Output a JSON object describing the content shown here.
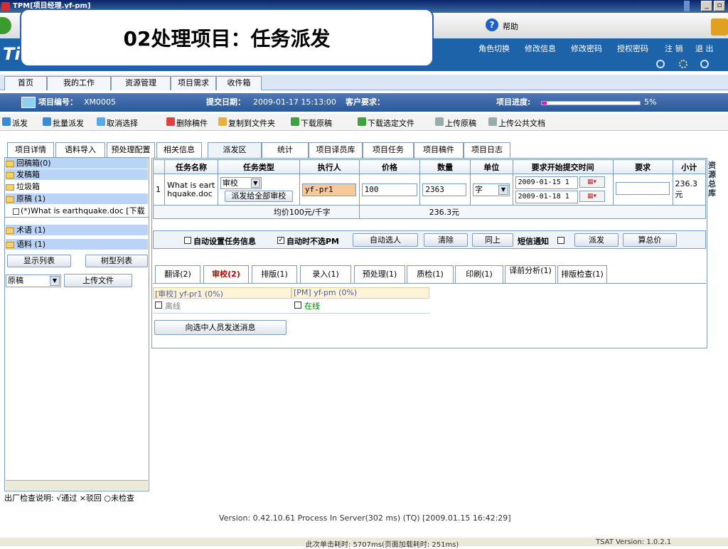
{
  "window": {
    "title": "TPM[项目经理.yf-pm]"
  },
  "toolbar": {
    "help_label": "帮助"
  },
  "overlay": {
    "title": "02处理项目：任务派发"
  },
  "brand": "Ti",
  "header_links": [
    "角色切换",
    "修改信息",
    "修改密码",
    "授权密码",
    "注 销",
    "退 出"
  ],
  "nav": {
    "tabs": [
      "首页",
      "我的工作",
      "资源管理",
      "项目需求",
      "收件箱"
    ]
  },
  "project": {
    "number_label": "项目编号：",
    "number": "XM0005",
    "date_label": "提交日期：",
    "date": "2009-01-17 15:13:00",
    "customer_label": "客户要求：",
    "progress_label": "项目进度:",
    "progress_pct": 5,
    "progress_text": "5%"
  },
  "actions": [
    "派发",
    "批量派发",
    "取消选择",
    "删除稿件",
    "复制到文件夹",
    "下载原稿",
    "下载选定文件",
    "上传原稿",
    "上传公共文档"
  ],
  "left_tabs": [
    "项目详情",
    "语料导入",
    "预处理配置"
  ],
  "tree": [
    {
      "label": "回稿箱(0)",
      "selected": true
    },
    {
      "label": "发稿箱",
      "selected": true
    },
    {
      "label": "垃圾箱",
      "selected": false
    },
    {
      "label": "原稿 (1)",
      "selected": true
    },
    {
      "label": "(*)What is earthquake.doc [下载",
      "selected": false
    },
    {
      "label": "术语 (1)",
      "selected": true
    },
    {
      "label": "语料 (1)",
      "selected": true
    }
  ],
  "left_buttons": {
    "show_list": "显示列表",
    "tree_list": "树型列表",
    "upload": "上传文件"
  },
  "left_select": "原稿",
  "main_tabs": [
    "相关信息",
    "派发区",
    "统计",
    "项目译员库",
    "项目任务",
    "项目稿件",
    "项目日志"
  ],
  "task_table": {
    "headers": [
      "任务名称",
      "任务类型",
      "执行人",
      "价格",
      "数量",
      "单位",
      "要求开始提交时间",
      "要求",
      "小计"
    ],
    "row": {
      "index": "1",
      "name": "What is earthquake.doc",
      "type": "审校",
      "dispatch_all": "派发给全部审校",
      "executor": "yf-pr1",
      "price": "100",
      "quantity": "2363",
      "unit": "字",
      "start": "2009-01-15 1",
      "end": "2009-01-18 1",
      "requirement": "",
      "subtotal": "236.3元"
    },
    "unit_price": "均价100元/千字",
    "total": "236.3元"
  },
  "options": {
    "auto_info": "自动设置任务信息",
    "auto_not_pm": "自动时不选PM",
    "auto_select": "自动选人",
    "clear": "清除",
    "same_above": "同上",
    "sms": "短信通知",
    "dispatch": "派发",
    "calc_total": "算总价"
  },
  "sub_tabs": [
    "翻译(2)",
    "审校(2)",
    "排版(1)",
    "录入(1)",
    "预处理(1)",
    "质检(1)",
    "印刷(1)",
    "译前分析(1)",
    "排版检查(1)"
  ],
  "workers": [
    {
      "role": "[审校] yf-pr1 (0%)",
      "status": "离线",
      "status_color": "#808080"
    },
    {
      "role": "[PM] yf-pm (0%)",
      "status": "在线",
      "status_color": "#008000"
    }
  ],
  "send_msg": "向选中人员发送消息",
  "right_rail": "资源总库",
  "legend": "出厂检查说明: √通过 ×驳回 ○未检查",
  "version": "Version: 0.42.10.61 Process In Server(302 ms) (TQ) [2009.01.15 16:42:29]",
  "status": {
    "timing": "此次单击耗时: 5707ms(页面加载耗时: 251ms)",
    "tsat": "TSAT Version: 1.0.2.1"
  }
}
